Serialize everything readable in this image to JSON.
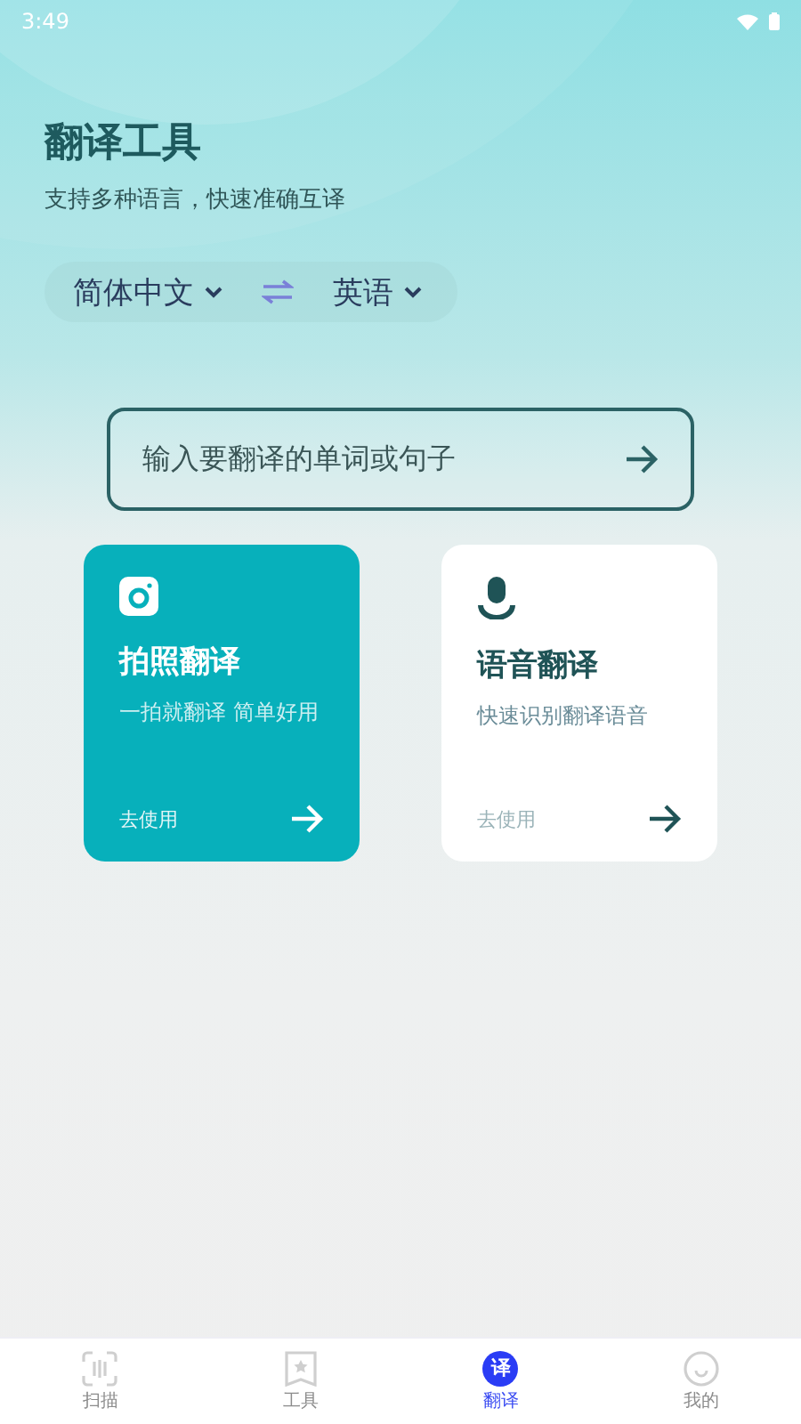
{
  "status_bar": {
    "time": "3:49"
  },
  "header": {
    "title": "翻译工具",
    "subtitle": "支持多种语言，快速准确互译"
  },
  "languages": {
    "source": "简体中文",
    "target": "英语"
  },
  "input": {
    "placeholder": "输入要翻译的单词或句子"
  },
  "cards": [
    {
      "kind": "camera",
      "title": "拍照翻译",
      "description": "一拍就翻译 简单好用",
      "action": "去使用",
      "selected": true
    },
    {
      "kind": "microphone",
      "title": "语音翻译",
      "description": "快速识别翻译语音",
      "action": "去使用",
      "selected": false
    }
  ],
  "bottom_nav": [
    {
      "kind": "scan",
      "label": "扫描",
      "selected": false
    },
    {
      "kind": "bookmark",
      "label": "工具",
      "selected": false
    },
    {
      "kind": "text",
      "icon_text": "译",
      "label": "翻译",
      "selected": true
    },
    {
      "kind": "face",
      "label": "我的",
      "selected": false
    }
  ]
}
